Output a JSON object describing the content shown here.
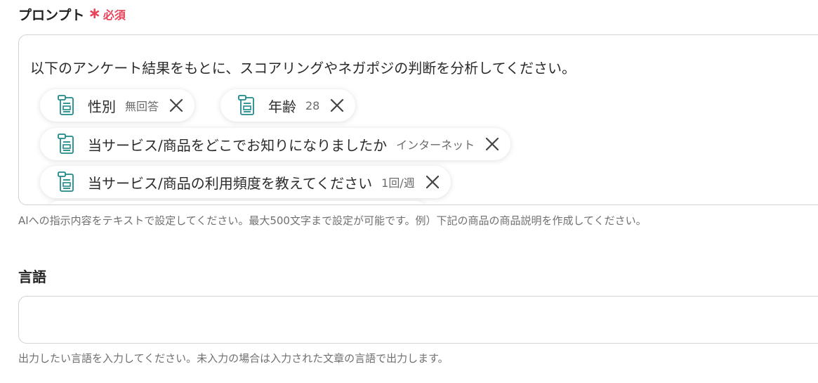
{
  "prompt_field": {
    "label": "プロンプト",
    "asterisk": "∗",
    "required_label": "必須",
    "text": "以下のアンケート結果をもとに、スコアリングやネガポジの判断を分析してください。",
    "chips": [
      {
        "label": "性別",
        "value": "無回答",
        "icon": "form-icon",
        "close_icon": "close-icon"
      },
      {
        "label": "年齢",
        "value": "28",
        "icon": "form-icon",
        "close_icon": "close-icon"
      },
      {
        "label": "当サービス/商品をどこでお知りになりましたか",
        "value": "インターネット",
        "icon": "form-icon",
        "close_icon": "close-icon"
      },
      {
        "label": "当サービス/商品の利用頻度を教えてください",
        "value": "1回/週",
        "icon": "form-icon",
        "close_icon": "close-icon"
      }
    ],
    "help_text": "AIへの指示内容をテキストで設定してください。最大500文字まで設定が可能です。例）下記の商品の商品説明を作成してください。"
  },
  "language_field": {
    "label": "言語",
    "value": "",
    "help_text": "出力したい言語を入力してください。未入力の場合は入力された文章の言語で出力します。"
  },
  "colors": {
    "required": "#e5445a",
    "icon_teal": "#1f8a8a",
    "border": "#d0d3d8",
    "help_text": "#707070"
  }
}
